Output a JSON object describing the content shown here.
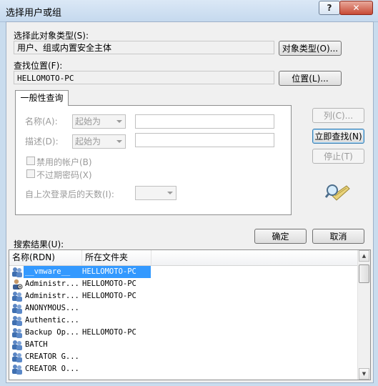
{
  "window": {
    "title": "选择用户或组",
    "help_label": "?",
    "close_label": "✕"
  },
  "object_type": {
    "label": "选择此对象类型(S):",
    "value": "用户、组或内置安全主体",
    "button": "对象类型(O)..."
  },
  "location": {
    "label": "查找位置(F):",
    "value": "HELLOMOTO-PC",
    "button": "位置(L)..."
  },
  "tab": {
    "label": "一般性查询"
  },
  "query": {
    "name_label": "名称(A):",
    "name_mode": "起始为",
    "desc_label": "描述(D):",
    "desc_mode": "起始为",
    "disabled_accounts": "禁用的帐户(B)",
    "no_expire_pwd": "不过期密码(X)",
    "days_since_logon": "自上次登录后的天数(I):"
  },
  "side_buttons": {
    "columns": "列(C)...",
    "find_now": "立即查找(N)",
    "stop": "停止(T)"
  },
  "results": {
    "label": "搜索结果(U):",
    "ok": "确定",
    "cancel": "取消",
    "columns": [
      "名称(RDN)",
      "所在文件夹"
    ],
    "rows": [
      {
        "name": "__vmware__",
        "folder": "HELLOMOTO-PC",
        "icon": "group-icon"
      },
      {
        "name": "Administr...",
        "folder": "HELLOMOTO-PC",
        "icon": "user-icon"
      },
      {
        "name": "Administr...",
        "folder": "HELLOMOTO-PC",
        "icon": "group-icon"
      },
      {
        "name": "ANONYMOUS...",
        "folder": "",
        "icon": "group-icon"
      },
      {
        "name": "Authentic...",
        "folder": "",
        "icon": "group-icon"
      },
      {
        "name": "Backup Op...",
        "folder": "HELLOMOTO-PC",
        "icon": "group-icon"
      },
      {
        "name": "BATCH",
        "folder": "",
        "icon": "group-icon"
      },
      {
        "name": "CREATOR G...",
        "folder": "",
        "icon": "group-icon"
      },
      {
        "name": "CREATOR O...",
        "folder": "",
        "icon": "group-icon"
      }
    ]
  },
  "colors": {
    "selection": "#3399ff",
    "frame": "#c9dcee",
    "close": "#c74a35"
  }
}
